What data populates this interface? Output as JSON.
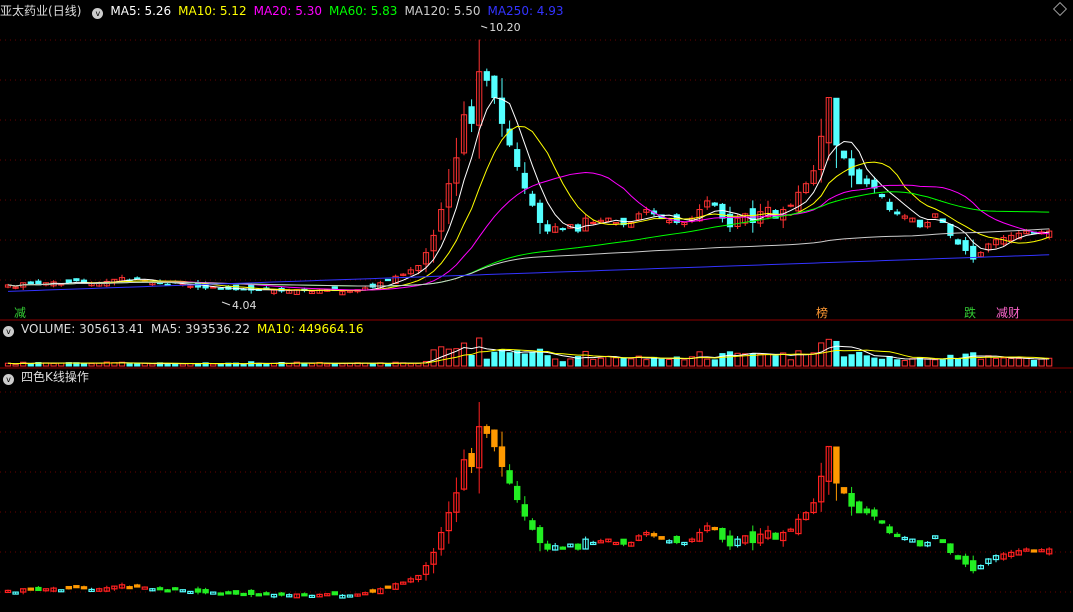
{
  "main_header": {
    "name": "亚太药业",
    "period": "(日线)",
    "ma5": "MA5: 5.26",
    "ma10": "MA10: 5.12",
    "ma20": "MA20: 5.30",
    "ma60": "MA60: 5.83",
    "ma120": "MA120: 5.50",
    "ma250": "MA250: 4.93"
  },
  "volume_header": {
    "vol": "VOLUME: 305613.41",
    "ma5": "MA5: 393536.22",
    "ma10": "MA10: 449664.16"
  },
  "indicator_header": {
    "title": "四色K线操作"
  },
  "annotations": {
    "high": "10.20",
    "low": "4.04"
  },
  "signals": [
    {
      "text": "减",
      "color": "#33cc33"
    },
    {
      "text": "榜",
      "color": "#ff9933"
    },
    {
      "text": "跌",
      "color": "#33cc33"
    },
    {
      "text": "减",
      "color": "#ff66cc"
    },
    {
      "text": "财",
      "color": "#ff66cc"
    }
  ],
  "colors": {
    "up": "#ff3232",
    "down": "#54ffff",
    "ma5": "#ffffff",
    "ma10": "#ffff00",
    "ma20": "#ff00ff",
    "ma60": "#00ff00",
    "ma120": "#cccccc",
    "ma250": "#3333ff",
    "q_red": "#ff2020",
    "q_orange": "#ff9900",
    "q_green": "#22ee22",
    "q_cyan": "#54ffff"
  },
  "chart_data": {
    "type": "candlestick",
    "title": "亚太药业 (日线)",
    "price_high": 10.2,
    "price_low": 4.04,
    "closes": [
      4.25,
      4.2,
      4.3,
      4.28,
      4.25,
      4.3,
      4.32,
      4.27,
      4.3,
      4.35,
      4.3,
      4.28,
      4.3,
      4.33,
      4.38,
      4.42,
      4.36,
      4.4,
      4.35,
      4.3,
      4.28,
      4.26,
      4.3,
      4.27,
      4.22,
      4.2,
      4.18,
      4.2,
      4.17,
      4.15,
      4.14,
      4.15,
      4.13,
      4.12,
      4.15,
      4.13,
      4.11,
      4.12,
      4.14,
      4.12,
      4.1,
      4.13,
      4.15,
      4.12,
      4.1,
      4.11,
      4.14,
      4.18,
      4.2,
      4.3,
      4.35,
      4.45,
      4.5,
      4.6,
      4.7,
      5.0,
      5.4,
      6.0,
      6.6,
      7.2,
      8.2,
      8.0,
      9.2,
      9.0,
      8.6,
      8.0,
      7.5,
      7.0,
      6.5,
      6.1,
      5.7,
      5.5,
      5.6,
      5.55,
      5.65,
      5.5,
      5.8,
      5.7,
      5.75,
      5.8,
      5.7,
      5.65,
      5.7,
      5.9,
      6.0,
      5.9,
      5.8,
      5.75,
      5.7,
      5.7,
      5.8,
      6.0,
      6.2,
      6.1,
      5.8,
      5.6,
      5.8,
      5.9,
      5.7,
      5.95,
      6.05,
      5.8,
      6.0,
      6.1,
      6.4,
      6.6,
      6.9,
      7.7,
      8.6,
      7.5,
      7.2,
      6.8,
      6.6,
      6.6,
      6.5,
      6.3,
      6.0,
      5.9,
      5.85,
      5.8,
      5.6,
      5.7,
      5.9,
      5.7,
      5.4,
      5.2,
      5.05,
      4.85,
      5.0,
      5.2,
      5.3,
      5.35,
      5.4,
      5.45,
      5.5,
      5.45,
      5.48,
      5.5
    ],
    "volume_header_values": {
      "volume": 305613.41,
      "ma5": 393536.22,
      "ma10": 449664.16
    },
    "moving_averages": {
      "MA5": 5.26,
      "MA10": 5.12,
      "MA20": 5.3,
      "MA60": 5.83,
      "MA120": 5.5,
      "MA250": 4.93
    }
  }
}
